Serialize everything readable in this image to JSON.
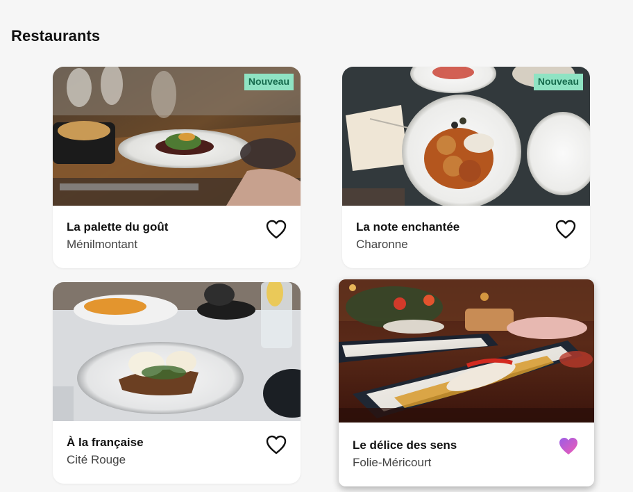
{
  "page": {
    "title": "Restaurants"
  },
  "restaurants": [
    {
      "name": "La palette du goût",
      "area": "Ménilmontant",
      "badge": "Nouveau",
      "favorite": false,
      "image_icon": "plated-dish-photo"
    },
    {
      "name": "La note enchantée",
      "area": "Charonne",
      "badge": "Nouveau",
      "favorite": false,
      "image_icon": "meatballs-dish-photo"
    },
    {
      "name": "À la française",
      "area": "Cité Rouge",
      "badge": "",
      "favorite": false,
      "image_icon": "eggs-benedict-photo"
    },
    {
      "name": "Le délice des sens",
      "area": "Folie-Méricourt",
      "badge": "",
      "favorite": true,
      "image_icon": "fish-platter-photo"
    }
  ],
  "colors": {
    "badge_bg": "#8fe3c3",
    "badge_text": "#166b4d",
    "favorite_gradient_start": "#9b5de5",
    "favorite_gradient_end": "#f15bb5",
    "background": "#f6f6f6"
  }
}
